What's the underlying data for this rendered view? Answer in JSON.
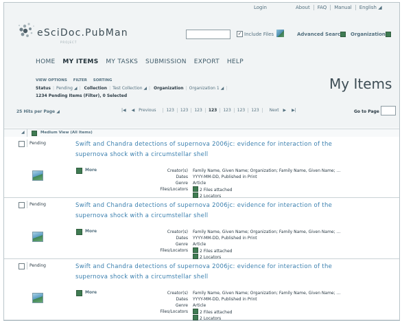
{
  "toplinks": [
    "Login",
    "About",
    "FAQ",
    "Manual",
    "English"
  ],
  "logo": {
    "title": "eSciDoc.PubMan",
    "subtitle": "PROJECT"
  },
  "search": {
    "include_files_label": "Include Files",
    "advanced_search": "Advanced Search",
    "organizations": "Organizations"
  },
  "nav": [
    "HOME",
    "MY ITEMS",
    "MY TASKS",
    "SUBMISSION",
    "EXPORT",
    "HELP"
  ],
  "nav_active": "MY ITEMS",
  "options": [
    "VIEW OPTIONS",
    "FILTER",
    "SORTING"
  ],
  "filters": {
    "status_label": "Status",
    "status_value": "Pending",
    "collection_label": "Collection",
    "collection_value": "Test Collection",
    "organization_label": "Organization",
    "organization_value": "Organization 1"
  },
  "count_text": "1234 Pending Items (Filter), 0 Selected",
  "page_title": "My Items",
  "hits_per_page": "25 Hits per Page",
  "pager": {
    "previous": "Previous",
    "next": "Next",
    "pages": [
      "123",
      "123",
      "123",
      "123",
      "123",
      "123",
      "123"
    ],
    "current_index": 3
  },
  "goto_label": "Go to Page",
  "list_header": "Medium View (All Items)",
  "item_labels": {
    "creators": "Creator(s)",
    "dates": "Dates",
    "genre": "Genre",
    "files": "Files/Locators",
    "more": "More"
  },
  "items": [
    {
      "state": "Pending",
      "title": "Swift and Chandra detections of supernova 2006jc: evidence for interaction of the supernova shock with a circumstellar shell",
      "creators": "Family Name, Given Name; Organization; Family Name, Given Name; ...",
      "dates": "YYYY-MM-DD, Published in Print",
      "genre": "Article",
      "files": "2 Files attached",
      "locators": "2 Locators"
    },
    {
      "state": "Pending",
      "title": "Swift and Chandra detections of supernova 2006jc: evidence for interaction of the supernova shock with a circumstellar shell",
      "creators": "Family Name, Given Name; Organization; Family Name, Given Name; ...",
      "dates": "YYYY-MM-DD, Published in Print",
      "genre": "Article",
      "files": "2 Files attached",
      "locators": "2 Locators"
    },
    {
      "state": "Pending",
      "title": "Swift and Chandra detections of supernova 2006jc: evidence for interaction of the supernova shock with a circumstellar shell",
      "creators": "Family Name, Given Name; Organization; Family Name, Given Name; ...",
      "dates": "YYYY-MM-DD, Published in Print",
      "genre": "Article",
      "files": "2 Files attached",
      "locators": "2 Locators"
    }
  ]
}
